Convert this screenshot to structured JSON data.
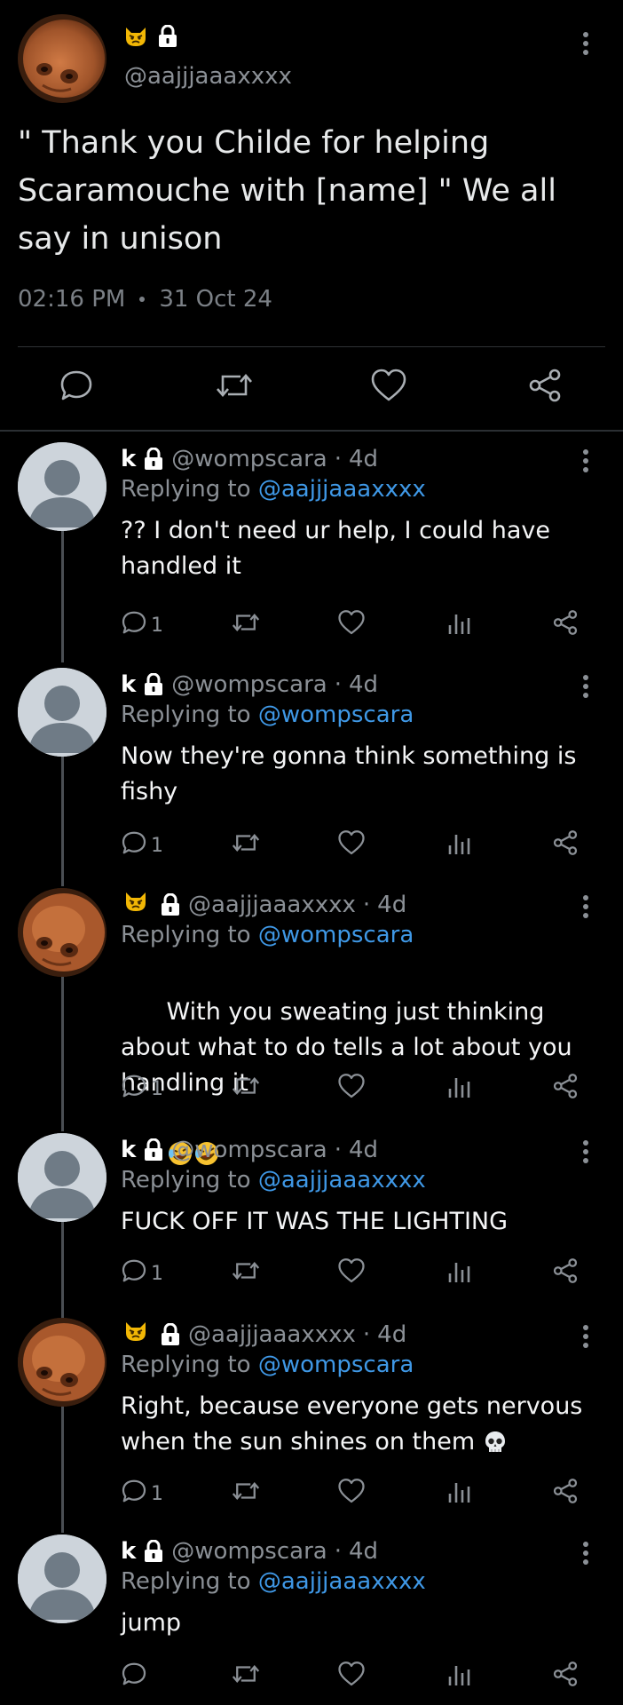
{
  "main_post": {
    "handle": "@aajjjaaaxxxx",
    "text": "\" Thank you Childe for helping Scaramouche with [name] \" We all say in unison",
    "time": "02:16 PM",
    "date": "31 Oct 24"
  },
  "replies": [
    {
      "name": "k",
      "handle": "@wompscara",
      "sep": "·",
      "age": "4d",
      "replying_label": "Replying to",
      "replying_to": "@aajjjaaaxxxx",
      "text": "?? I don't need ur help, I could have handled it",
      "reply_count": "1",
      "avatar": "default"
    },
    {
      "name": "k",
      "handle": "@wompscara",
      "sep": "·",
      "age": "4d",
      "replying_label": "Replying to",
      "replying_to": "@wompscara",
      "text": "Now they're gonna think something is fishy",
      "reply_count": "1",
      "avatar": "default"
    },
    {
      "name": "",
      "handle": "@aajjjaaaxxxx",
      "sep": "·",
      "age": "4d",
      "replying_label": "Replying to",
      "replying_to": "@wompscara",
      "text": "With you sweating just thinking about what to do tells a lot about you handling it",
      "reply_count": "1",
      "avatar": "photo"
    },
    {
      "name": "k",
      "handle": "@wompscara",
      "sep": "·",
      "age": "4d",
      "replying_label": "Replying to",
      "replying_to": "@aajjjaaaxxxx",
      "text": "FUCK OFF IT WAS THE LIGHTING",
      "reply_count": "1",
      "avatar": "default"
    },
    {
      "name": "",
      "handle": "@aajjjaaaxxxx",
      "sep": "·",
      "age": "4d",
      "replying_label": "Replying to",
      "replying_to": "@wompscara",
      "text": "Right, because everyone gets nervous when the sun shines on them",
      "reply_count": "1",
      "avatar": "photo"
    },
    {
      "name": "k",
      "handle": "@wompscara",
      "sep": "·",
      "age": "4d",
      "replying_label": "Replying to",
      "replying_to": "@aajjjaaaxxxx",
      "text": "jump",
      "reply_count": "",
      "avatar": "default"
    }
  ],
  "icons": {
    "reply": "reply-icon",
    "retweet": "retweet-icon",
    "like": "heart-icon",
    "views": "views-icon",
    "share": "share-icon",
    "more": "more-icon",
    "lock": "lock-icon",
    "cat_emoji": "angry-cat-emoji",
    "laugh_emoji": "rolling-laughing-emoji",
    "skull_emoji": "skull-emoji"
  },
  "colors": {
    "background": "#000000",
    "text": "#e7e9ea",
    "muted": "#8b9096",
    "mention": "#3f98e6"
  }
}
